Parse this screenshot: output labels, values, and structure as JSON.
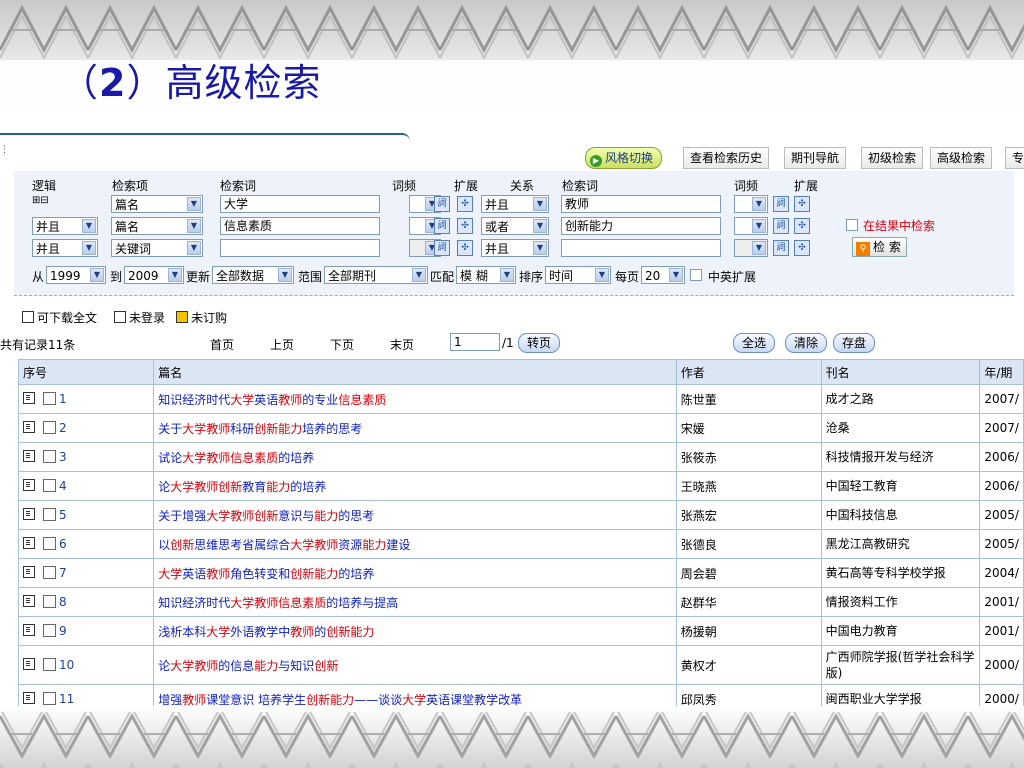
{
  "slide": {
    "title_open": "（",
    "title_num": "2",
    "title_rest": "）高级检索"
  },
  "toolbar": {
    "style_switch": "风格切换",
    "history": "查看检索历史",
    "journal_nav": "期刊导航",
    "basic_search": "初级检索",
    "advanced_search": "高级检索",
    "more": "专"
  },
  "search_panel": {
    "headers": {
      "logic": "逻辑",
      "field": "检索项",
      "term": "检索词",
      "freq": "词频",
      "expand": "扩展",
      "relation": "关系",
      "term2": "检索词",
      "freq2": "词频",
      "expand2": "扩展"
    },
    "plus_minus": "⊞⊟",
    "rows": [
      {
        "logic": "",
        "field": "篇名",
        "term": "大学",
        "relation": "并且",
        "term2": "教师"
      },
      {
        "logic": "并且",
        "field": "篇名",
        "term": "信息素质",
        "relation": "或者",
        "term2": "创新能力"
      },
      {
        "logic": "并且",
        "field": "关键词",
        "term": "",
        "relation": "并且",
        "term2": ""
      }
    ],
    "in_results": "在结果中检索",
    "search_button": "检 索",
    "bottom": {
      "from_label": "从",
      "from_year": "1999",
      "to_label": "到",
      "to_year": "2009",
      "update_label": "更新",
      "update_value": "全部数据",
      "range_label": "范围",
      "range_value": "全部期刊",
      "match_label": "匹配",
      "match_value": "模 糊",
      "sort_label": "排序",
      "sort_value": "时间",
      "per_page_label": "每页",
      "per_page_value": "20",
      "cn_en_label": "中英扩展"
    }
  },
  "legend": {
    "downloadable": "可下载全文",
    "not_logged": "未登录",
    "not_subscribed": "未订购"
  },
  "pager": {
    "total": "共有记录11条",
    "first": "首页",
    "prev": "上页",
    "next": "下页",
    "last": "末页",
    "page_value": "1",
    "page_total": "/1",
    "go": "转页",
    "select_all": "全选",
    "clear": "清除",
    "save": "存盘"
  },
  "table": {
    "columns": [
      "序号",
      "篇名",
      "作者",
      "刊名",
      "年/期"
    ],
    "rows": [
      {
        "no": "1",
        "title_parts": [
          [
            "知识经济时代",
            "b"
          ],
          [
            "大学",
            "r"
          ],
          [
            "英语",
            "b"
          ],
          [
            "教师",
            "r"
          ],
          [
            "的专业",
            "b"
          ],
          [
            "信息素质",
            "r"
          ]
        ],
        "author": "陈世董",
        "journal": "成才之路",
        "year": "2007/"
      },
      {
        "no": "2",
        "title_parts": [
          [
            "关于",
            "b"
          ],
          [
            "大学教师",
            "r"
          ],
          [
            "科研",
            "b"
          ],
          [
            "创新能力",
            "r"
          ],
          [
            "培养的思考",
            "b"
          ]
        ],
        "author": "宋媛",
        "journal": "沧桑",
        "year": "2007/"
      },
      {
        "no": "3",
        "title_parts": [
          [
            "试论",
            "b"
          ],
          [
            "大学教师信息素质",
            "r"
          ],
          [
            "的培养",
            "b"
          ]
        ],
        "author": "张筱赤",
        "journal": "科技情报开发与经济",
        "year": "2006/"
      },
      {
        "no": "4",
        "title_parts": [
          [
            "论",
            "b"
          ],
          [
            "大学教师创新",
            "r"
          ],
          [
            "教育",
            "b"
          ],
          [
            "能力",
            "r"
          ],
          [
            "的培养",
            "b"
          ]
        ],
        "author": "王晓燕",
        "journal": "中国轻工教育",
        "year": "2006/"
      },
      {
        "no": "5",
        "title_parts": [
          [
            "关于增强",
            "b"
          ],
          [
            "大学教师创新",
            "r"
          ],
          [
            "意识与",
            "b"
          ],
          [
            "能力",
            "r"
          ],
          [
            "的思考",
            "b"
          ]
        ],
        "author": "张燕宏",
        "journal": "中国科技信息",
        "year": "2005/"
      },
      {
        "no": "6",
        "title_parts": [
          [
            "以",
            "b"
          ],
          [
            "创新",
            "r"
          ],
          [
            "思维思考省属综合",
            "b"
          ],
          [
            "大学教师",
            "r"
          ],
          [
            "资源",
            "b"
          ],
          [
            "能力",
            "r"
          ],
          [
            "建设",
            "b"
          ]
        ],
        "author": "张德良",
        "journal": "黑龙江高教研究",
        "year": "2005/"
      },
      {
        "no": "7",
        "title_parts": [
          [
            "大学",
            "r"
          ],
          [
            "英语",
            "b"
          ],
          [
            "教师",
            "r"
          ],
          [
            "角色转变和",
            "b"
          ],
          [
            "创新能力",
            "r"
          ],
          [
            "的培养",
            "b"
          ]
        ],
        "author": "周会碧",
        "journal": "黄石高等专科学校学报",
        "year": "2004/"
      },
      {
        "no": "8",
        "title_parts": [
          [
            "知识经济时代",
            "b"
          ],
          [
            "大学教师信息素质",
            "r"
          ],
          [
            "的培养与提高",
            "b"
          ]
        ],
        "author": "赵群华",
        "journal": "情报资料工作",
        "year": "2001/"
      },
      {
        "no": "9",
        "title_parts": [
          [
            "浅析本科",
            "b"
          ],
          [
            "大学",
            "r"
          ],
          [
            "外语教学中",
            "b"
          ],
          [
            "教师",
            "r"
          ],
          [
            "的",
            "b"
          ],
          [
            "创新能力",
            "r"
          ]
        ],
        "author": "杨援朝",
        "journal": "中国电力教育",
        "year": "2001/"
      },
      {
        "no": "10",
        "title_parts": [
          [
            "论",
            "b"
          ],
          [
            "大学教师",
            "r"
          ],
          [
            "的信息",
            "b"
          ],
          [
            "能力",
            "r"
          ],
          [
            "与知识",
            "b"
          ],
          [
            "创新",
            "r"
          ]
        ],
        "author": "黄权才",
        "journal": "广西师院学报(哲学社会科学版)",
        "year": "2000/"
      },
      {
        "no": "11",
        "title_parts": [
          [
            "增强",
            "b"
          ],
          [
            "教师",
            "r"
          ],
          [
            "课堂意识  培养学生",
            "b"
          ],
          [
            "创新能力",
            "r"
          ],
          [
            "——谈谈",
            "b"
          ],
          [
            "大学",
            "r"
          ],
          [
            "英语课堂教学改革",
            "b"
          ]
        ],
        "author": "邱凤秀",
        "journal": "闽西职业大学学报",
        "year": "2000/"
      }
    ]
  },
  "colors": {
    "title": "#1a1aa6",
    "highlight": "#d8000c",
    "link": "#1f3fa0",
    "header_bg": "#dbe6f5"
  }
}
